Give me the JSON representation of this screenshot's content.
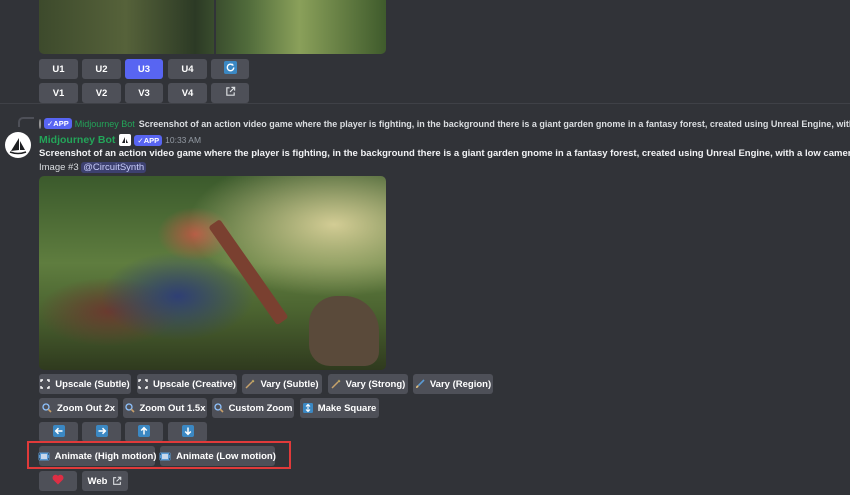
{
  "top_buttons": {
    "upscale_row": [
      "U1",
      "U2",
      "U3",
      "U4"
    ],
    "variation_row": [
      "V1",
      "V2",
      "V3",
      "V4"
    ],
    "refresh_icon": "refresh-icon",
    "open_icon": "external-link-icon"
  },
  "reply": {
    "app_badge": "APP",
    "author": "Midjourney Bot",
    "text": "Screenshot of an action video game where the player is fighting, in the background there is a giant garden gnome in a fantasy forest, created using Unreal Engine, with a low camera ar"
  },
  "message": {
    "author": "Midjourney Bot",
    "app_badge": "APP",
    "time": "10:33 AM",
    "prompt": "Screenshot of an action video game where the player is fighting, in the background there is a giant garden gnome in a fantasy forest, created using Unreal Engine, with a low camera ar",
    "image_label": "Image #3",
    "mention": "@CircuitSynth"
  },
  "actions": {
    "row1": [
      "Upscale (Subtle)",
      "Upscale (Creative)",
      "Vary (Subtle)",
      "Vary (Strong)",
      "Vary (Region)"
    ],
    "row2": [
      "Zoom Out 2x",
      "Zoom Out 1.5x",
      "Custom Zoom",
      "Make Square"
    ],
    "row4": [
      "Animate (High motion)",
      "Animate (Low motion)"
    ],
    "web_label": "Web"
  },
  "colors": {
    "background": "#313338",
    "button": "#4e5058",
    "primary": "#5865f2",
    "bot_name": "#23a559",
    "highlight": "#e03a3a"
  }
}
